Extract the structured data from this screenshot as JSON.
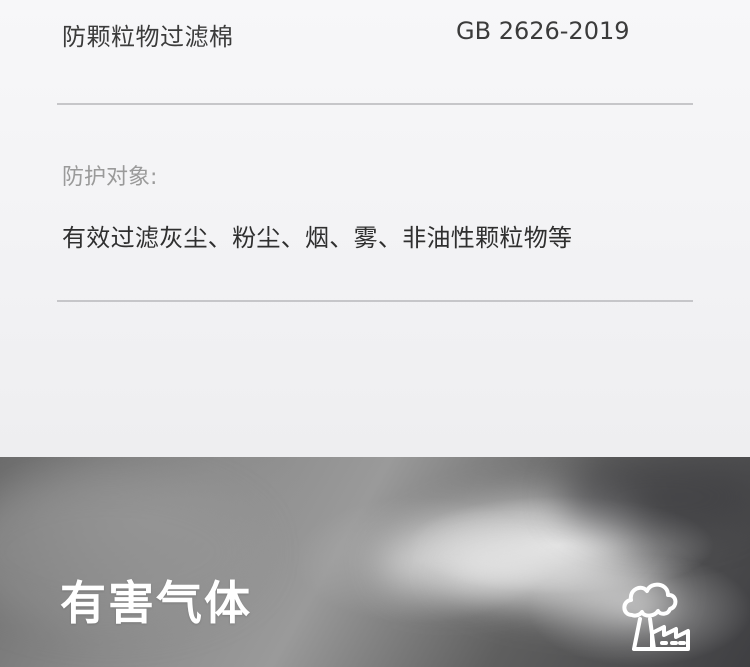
{
  "spec": {
    "filter_name": "防颗粒物过滤棉",
    "standard": "GB 2626-2019"
  },
  "protection": {
    "label": "防护对象:",
    "description": "有效过滤灰尘、粉尘、烟、雾、非油性颗粒物等"
  },
  "banner": {
    "title": "有害气体",
    "icon": "factory-pollution-icon"
  }
}
